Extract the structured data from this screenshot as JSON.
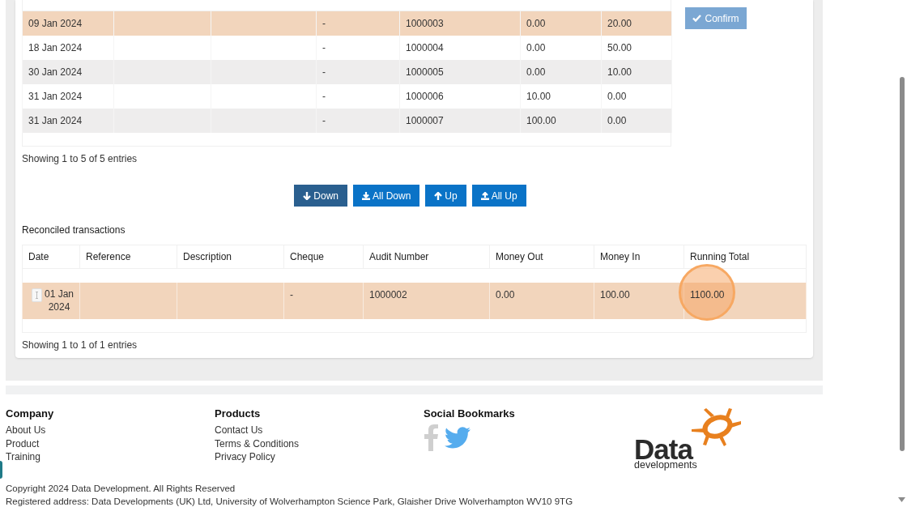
{
  "pending_table": {
    "rows": [
      {
        "date": "09 Jan 2024",
        "cheque": "-",
        "audit_number": "1000003",
        "money_out": "0.00",
        "money_in": "20.00",
        "selected": true
      },
      {
        "date": "18 Jan 2024",
        "cheque": "-",
        "audit_number": "1000004",
        "money_out": "0.00",
        "money_in": "50.00",
        "selected": false
      },
      {
        "date": "30 Jan 2024",
        "cheque": "-",
        "audit_number": "1000005",
        "money_out": "0.00",
        "money_in": "10.00",
        "selected": false
      },
      {
        "date": "31 Jan 2024",
        "cheque": "-",
        "audit_number": "1000006",
        "money_out": "10.00",
        "money_in": "0.00",
        "selected": false
      },
      {
        "date": "31 Jan 2024",
        "cheque": "-",
        "audit_number": "1000007",
        "money_out": "100.00",
        "money_in": "0.00",
        "selected": false
      }
    ],
    "info": "Showing 1 to 5 of 5 entries"
  },
  "confirm_button": {
    "label": "Confirm",
    "disabled": true
  },
  "move_buttons": [
    {
      "label": "Down",
      "kind": "down",
      "active": true
    },
    {
      "label": "All Down",
      "kind": "all_down",
      "active": false
    },
    {
      "label": "Up",
      "kind": "up",
      "active": false
    },
    {
      "label": "All Up",
      "kind": "all_up",
      "active": false
    }
  ],
  "reconciled": {
    "title": "Reconciled transactions",
    "columns": [
      "Date",
      "Reference",
      "Description",
      "Cheque",
      "Audit Number",
      "Money Out",
      "Money In",
      "Running Total"
    ],
    "rows": [
      {
        "date": "01 Jan 2024",
        "cheque": "-",
        "audit_number": "1000002",
        "money_out": "0.00",
        "money_in": "100.00",
        "running_total": "1100.00",
        "selected": true
      }
    ],
    "info": "Showing 1 to 1 of 1 entries"
  },
  "footer": {
    "columns": [
      {
        "heading": "Company",
        "links": [
          "About Us",
          "Product",
          "Training"
        ]
      },
      {
        "heading": "Products",
        "links": [
          "Contact Us",
          "Terms & Conditions",
          "Privacy Policy"
        ]
      }
    ],
    "social_heading": "Social Bookmarks",
    "logo": {
      "name": "Data",
      "tagline": "developments"
    },
    "copyright": "Copyright 2024 Data Development. All Rights Reserved",
    "address": "Registered address: Data Developments (UK) Ltd, University of Wolverhampton Science Park, Glaisher Drive Wolverhampton WV10 9TG"
  }
}
